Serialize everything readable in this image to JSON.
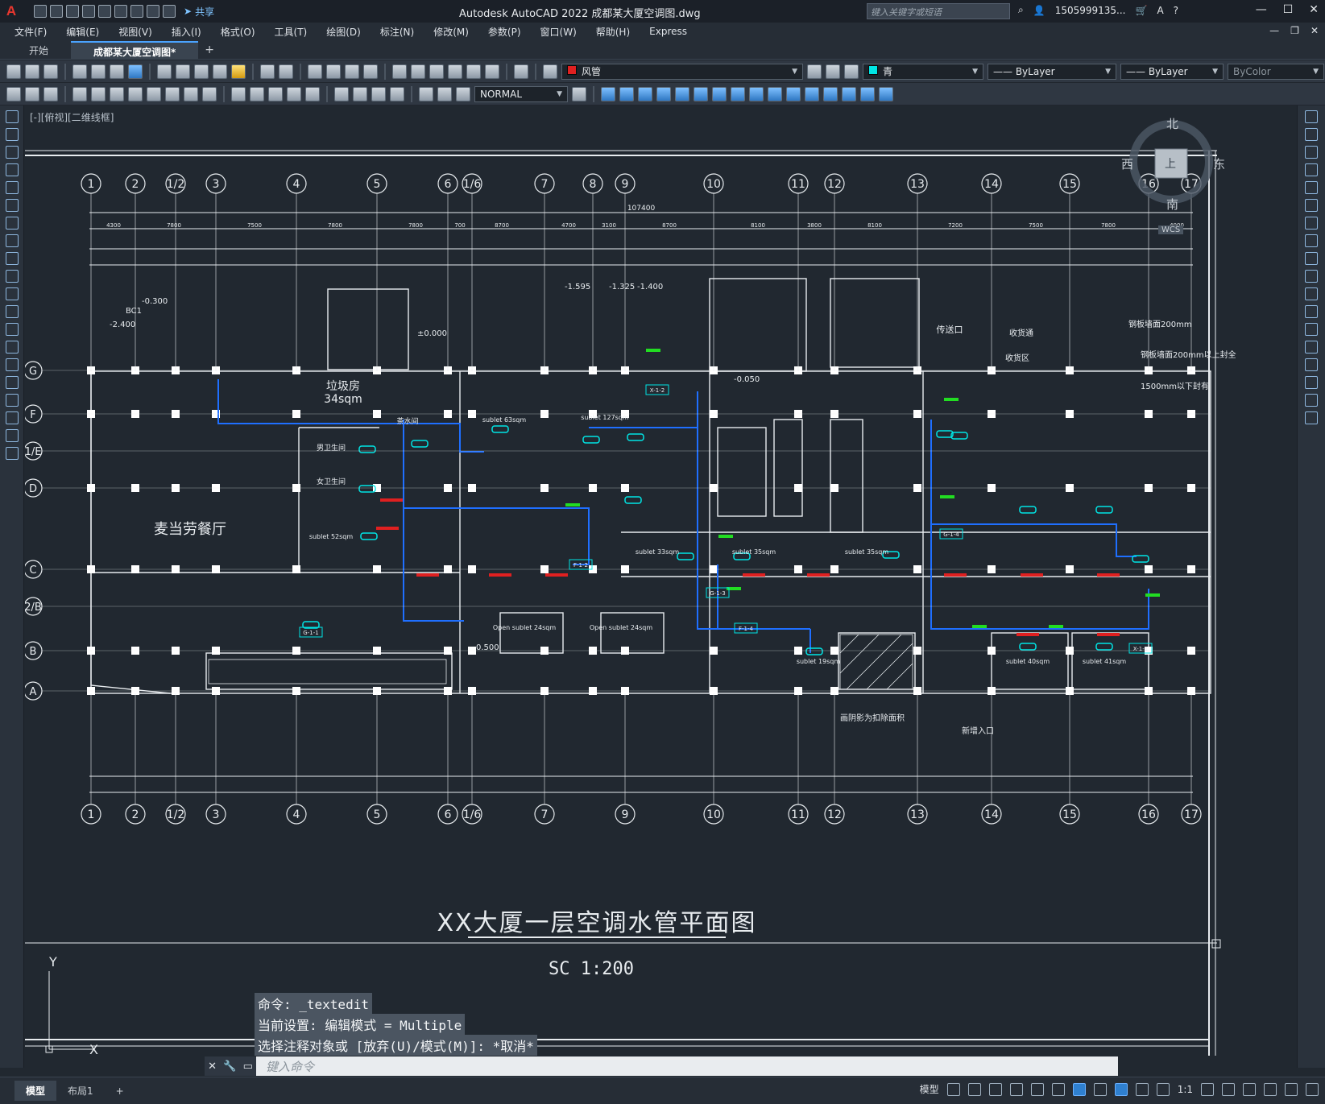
{
  "title_bar": {
    "app_logo": "A",
    "share_label": "共享",
    "app_title": "Autodesk AutoCAD 2022    成都某大厦空调图.dwg",
    "search_placeholder": "键入关键字或短语",
    "user": "1505999135...",
    "icons": [
      "new-icon",
      "open-icon",
      "save-icon",
      "saveas-icon",
      "plot-icon",
      "undo-icon",
      "redo-icon",
      "search-icon",
      "user-icon",
      "cart-icon",
      "help-icon"
    ]
  },
  "menu": [
    "文件(F)",
    "编辑(E)",
    "视图(V)",
    "插入(I)",
    "格式(O)",
    "工具(T)",
    "绘图(D)",
    "标注(N)",
    "修改(M)",
    "参数(P)",
    "窗口(W)",
    "帮助(H)",
    "Express"
  ],
  "tabs": [
    {
      "label": "开始",
      "active": false
    },
    {
      "label": "成都某大厦空调图*",
      "active": true
    }
  ],
  "toolbar": {
    "layer_name": "风管",
    "layer_color": "#e02020",
    "color_name": "青",
    "color_swatch": "#00e5e5",
    "linetype": "ByLayer",
    "lineweight": "ByLayer",
    "plotstyle": "ByColor",
    "textstyle": "NORMAL"
  },
  "viewport": {
    "label": "[-][俯视][二维线框]"
  },
  "viewcube": {
    "north": "北",
    "south": "南",
    "west": "西",
    "east": "东",
    "top": "上",
    "wcs": "WCS"
  },
  "drawing": {
    "top_grid_labels": [
      "1",
      "2",
      "1/2",
      "3",
      "4",
      "5",
      "6",
      "1/6",
      "7",
      "8",
      "9",
      "10",
      "11",
      "12",
      "13",
      "14",
      "15",
      "16",
      "17"
    ],
    "bottom_grid_labels": [
      "1",
      "2",
      "1/2",
      "3",
      "4",
      "5",
      "6",
      "1/6",
      "7",
      "9",
      "10",
      "11",
      "12",
      "13",
      "14",
      "15",
      "16",
      "17"
    ],
    "row_labels": [
      "G",
      "F",
      "1/E",
      "D",
      "C",
      "2/B",
      "B",
      "A"
    ],
    "overall_dim": "107400",
    "top_dims": [
      "4300",
      "7800",
      "7500",
      "7800",
      "7800",
      "700",
      "8700",
      "4700",
      "3100",
      "8700",
      "8100",
      "3800",
      "8100",
      "7200",
      "7500",
      "7800",
      "4000"
    ],
    "rooms": [
      {
        "name": "麦当劳餐厅"
      },
      {
        "name": "垃圾房"
      },
      {
        "name": "34sqm"
      },
      {
        "name": "男卫生间"
      },
      {
        "name": "女卫生间"
      },
      {
        "name": "茶水间"
      },
      {
        "name": "sublet 63sqm"
      },
      {
        "name": "sublet 127sqm"
      },
      {
        "name": "sublet 52sqm"
      },
      {
        "name": "sublet 33sqm"
      },
      {
        "name": "sublet 35sqm"
      },
      {
        "name": "sublet 35sqm"
      },
      {
        "name": "Open sublet 24sqm"
      },
      {
        "name": "Open sublet 24sqm"
      },
      {
        "name": "sublet 19sqm"
      },
      {
        "name": "sublet 40sqm"
      },
      {
        "name": "sublet 41sqm"
      },
      {
        "name": "传送口"
      },
      {
        "name": "收货通"
      },
      {
        "name": "收货区"
      },
      {
        "name": "新增入口"
      },
      {
        "name": "画阴影为扣除面积"
      }
    ],
    "annotations": [
      "±0.000",
      "-0.300",
      "-2.400",
      "BC1",
      "-1.595",
      "-1.325",
      "-1.400",
      "0.500",
      "-0.050",
      "钢板墙面200mm",
      "钢板墙面200mm以上封全",
      "1500mm以下封有"
    ],
    "equipment_tags": [
      "X-1-2",
      "G-1-3",
      "G-1-4",
      "F-1-4",
      "F-1-2",
      "G-1-1",
      "X-1-1"
    ],
    "drawing_title": "XX大厦一层空调水管平面图",
    "scale_label": "SC    1:200",
    "ucs_y": "Y",
    "ucs_x": "X"
  },
  "command": {
    "history": [
      "命令: _textedit",
      "当前设置: 编辑模式 = Multiple",
      "选择注释对象或 [放弃(U)/模式(M)]: *取消*"
    ],
    "input_placeholder": "键入命令"
  },
  "status": {
    "layout_tabs": [
      {
        "label": "模型",
        "active": true
      },
      {
        "label": "布局1",
        "active": false
      }
    ],
    "add_tab": "+",
    "model_label": "模型",
    "scale": "1:1"
  },
  "colors": {
    "pipe_blue": "#1f6fff",
    "duct_cyan": "#00e5e5",
    "red_mark": "#e02020",
    "green_mark": "#22dd22",
    "line_white": "#e8ecef"
  }
}
